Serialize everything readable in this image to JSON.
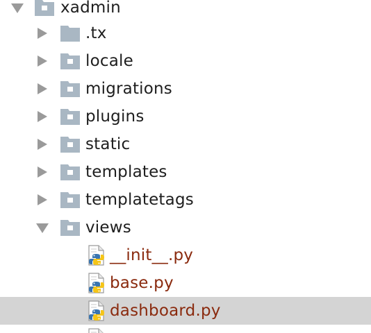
{
  "colors": {
    "folder": "#a9b7c3",
    "folder_dot": "#ffffff",
    "arrow": "#9a9a9a",
    "modified_file_text": "#8a2a0e",
    "folder_text": "#1e1e1e",
    "selection": "#d4d4d4"
  },
  "tree": {
    "root": {
      "label": "xadmin",
      "state": "expanded"
    },
    "children": [
      {
        "label": ".tx",
        "state": "collapsed",
        "icon": "folder-icon"
      },
      {
        "label": "locale",
        "state": "collapsed",
        "icon": "package-folder-icon"
      },
      {
        "label": "migrations",
        "state": "collapsed",
        "icon": "package-folder-icon"
      },
      {
        "label": "plugins",
        "state": "collapsed",
        "icon": "package-folder-icon"
      },
      {
        "label": "static",
        "state": "collapsed",
        "icon": "package-folder-icon"
      },
      {
        "label": "templates",
        "state": "collapsed",
        "icon": "package-folder-icon"
      },
      {
        "label": "templatetags",
        "state": "collapsed",
        "icon": "package-folder-icon"
      },
      {
        "label": "views",
        "state": "expanded",
        "icon": "package-folder-icon"
      }
    ],
    "views_files": [
      {
        "label": "__init__.py",
        "icon": "python-file-icon",
        "selected": false
      },
      {
        "label": "base.py",
        "icon": "python-file-icon",
        "selected": false
      },
      {
        "label": "dashboard.py",
        "icon": "python-file-icon",
        "selected": true
      }
    ]
  }
}
